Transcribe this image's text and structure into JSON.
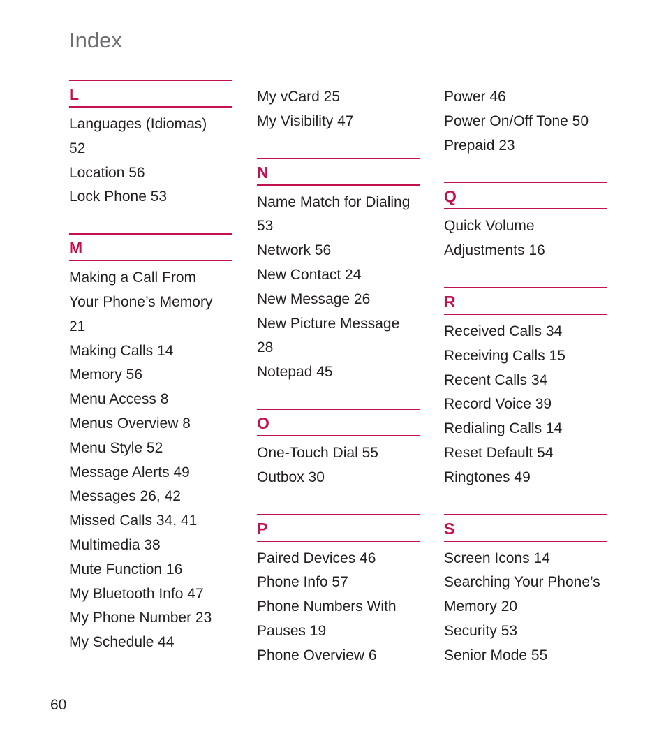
{
  "page": {
    "title": "Index",
    "page_number": "60"
  },
  "accent_color": "#c4104f",
  "columns": [
    {
      "sections": [
        {
          "letter": "L",
          "entries": [
            "Languages (Idiomas)",
            "52",
            "Location  56",
            "Lock Phone  53"
          ]
        },
        {
          "letter": "M",
          "entries": [
            "Making a Call From",
            "Your Phone’s Memory",
            "21",
            "Making Calls  14",
            "Memory  56",
            "Menu Access  8",
            "Menus Overview  8",
            "Menu Style  52",
            "Message Alerts  49",
            "Messages  26, 42",
            "Missed Calls  34, 41",
            "Multimedia  38",
            "Mute Function  16",
            "My Bluetooth Info  47",
            "My Phone Number  23",
            "My Schedule  44"
          ]
        }
      ]
    },
    {
      "continued_entries": [
        "My vCard  25",
        "My Visibility  47"
      ],
      "sections": [
        {
          "letter": "N",
          "entries": [
            "Name Match for Dialing",
            "53",
            "Network  56",
            "New Contact  24",
            "New Message  26",
            "New Picture Message",
            "28",
            "Notepad  45"
          ]
        },
        {
          "letter": "O",
          "entries": [
            "One-Touch Dial  55",
            "Outbox  30"
          ]
        },
        {
          "letter": "P",
          "entries": [
            "Paired Devices  46",
            "Phone Info  57",
            "Phone Numbers With",
            "Pauses  19",
            "Phone Overview  6"
          ]
        }
      ]
    },
    {
      "continued_entries": [
        "Power  46",
        "Power On/Off Tone  50",
        "Prepaid  23"
      ],
      "sections": [
        {
          "letter": "Q",
          "entries": [
            "Quick Volume",
            "Adjustments  16"
          ]
        },
        {
          "letter": "R",
          "entries": [
            "Received Calls  34",
            "Receiving Calls  15",
            "Recent Calls  34",
            "Record Voice  39",
            "Redialing Calls  14",
            "Reset Default  54",
            "Ringtones  49"
          ]
        },
        {
          "letter": "S",
          "entries": [
            "Screen Icons  14",
            "Searching Your Phone’s",
            "Memory  20",
            "Security  53",
            "Senior Mode  55"
          ]
        }
      ]
    }
  ]
}
